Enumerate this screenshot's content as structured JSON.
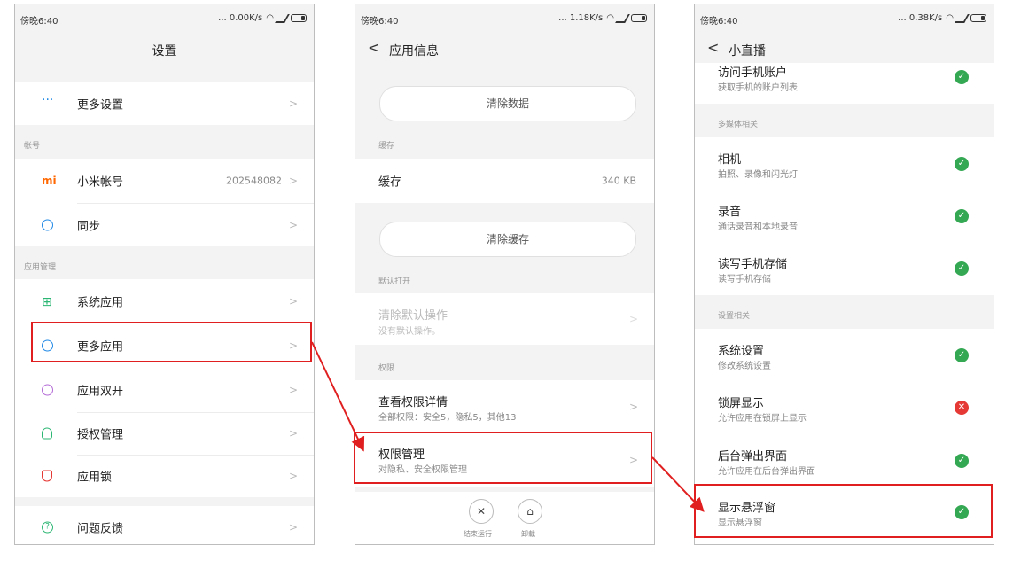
{
  "panel1": {
    "status": {
      "time": "傍晚6:40",
      "speed": "... 0.00K/s"
    },
    "title": "设置",
    "sections": {
      "account": "帐号",
      "apps": "应用管理"
    },
    "items": {
      "more_settings": "更多设置",
      "mi_account": "小米帐号",
      "mi_account_value": "202548082",
      "sync": "同步",
      "system_apps": "系统应用",
      "more_apps": "更多应用",
      "dual_apps": "应用双开",
      "permissions": "授权管理",
      "app_lock": "应用锁",
      "feedback": "问题反馈"
    },
    "icon_text": {
      "mi": "mi",
      "feedback": "?"
    }
  },
  "panel2": {
    "status": {
      "time": "傍晚6:40",
      "speed": "... 1.18K/s"
    },
    "title": "应用信息",
    "clear_data": "清除数据",
    "storage_section": "缓存",
    "cache_label": "缓存",
    "cache_value": "340 KB",
    "clear_cache": "清除缓存",
    "default_section": "默认打开",
    "clear_default_title": "清除默认操作",
    "clear_default_sub": "没有默认操作。",
    "perm_section": "权限",
    "perm_detail_title": "查看权限详情",
    "perm_detail_sub": "全部权限：安全5，隐私5，其他13",
    "perm_manage_title": "权限管理",
    "perm_manage_sub": "对隐私、安全权限管理",
    "actions": {
      "stop": "结束运行",
      "uninstall": "卸载"
    }
  },
  "panel3": {
    "status": {
      "time": "傍晚6:40",
      "speed": "... 0.38K/s"
    },
    "title": "小直播",
    "rows": [
      {
        "title": "访问手机账户",
        "sub": "获取手机的账户列表",
        "state": "allow"
      },
      {
        "title": "相机",
        "sub": "拍照、录像和闪光灯",
        "state": "allow"
      },
      {
        "title": "录音",
        "sub": "通话录音和本地录音",
        "state": "allow"
      },
      {
        "title": "读写手机存储",
        "sub": "读写手机存储",
        "state": "allow"
      },
      {
        "title": "系统设置",
        "sub": "修改系统设置",
        "state": "allow"
      },
      {
        "title": "锁屏显示",
        "sub": "允许应用在锁屏上显示",
        "state": "deny"
      },
      {
        "title": "后台弹出界面",
        "sub": "允许应用在后台弹出界面",
        "state": "allow"
      },
      {
        "title": "显示悬浮窗",
        "sub": "显示悬浮窗",
        "state": "allow"
      }
    ],
    "sections": {
      "media": "多媒体相关",
      "settings": "设置相关"
    }
  },
  "colors": {
    "highlight": "#e02020",
    "allow": "#34a853",
    "deny": "#e53935",
    "accent": "#1e88e5"
  }
}
